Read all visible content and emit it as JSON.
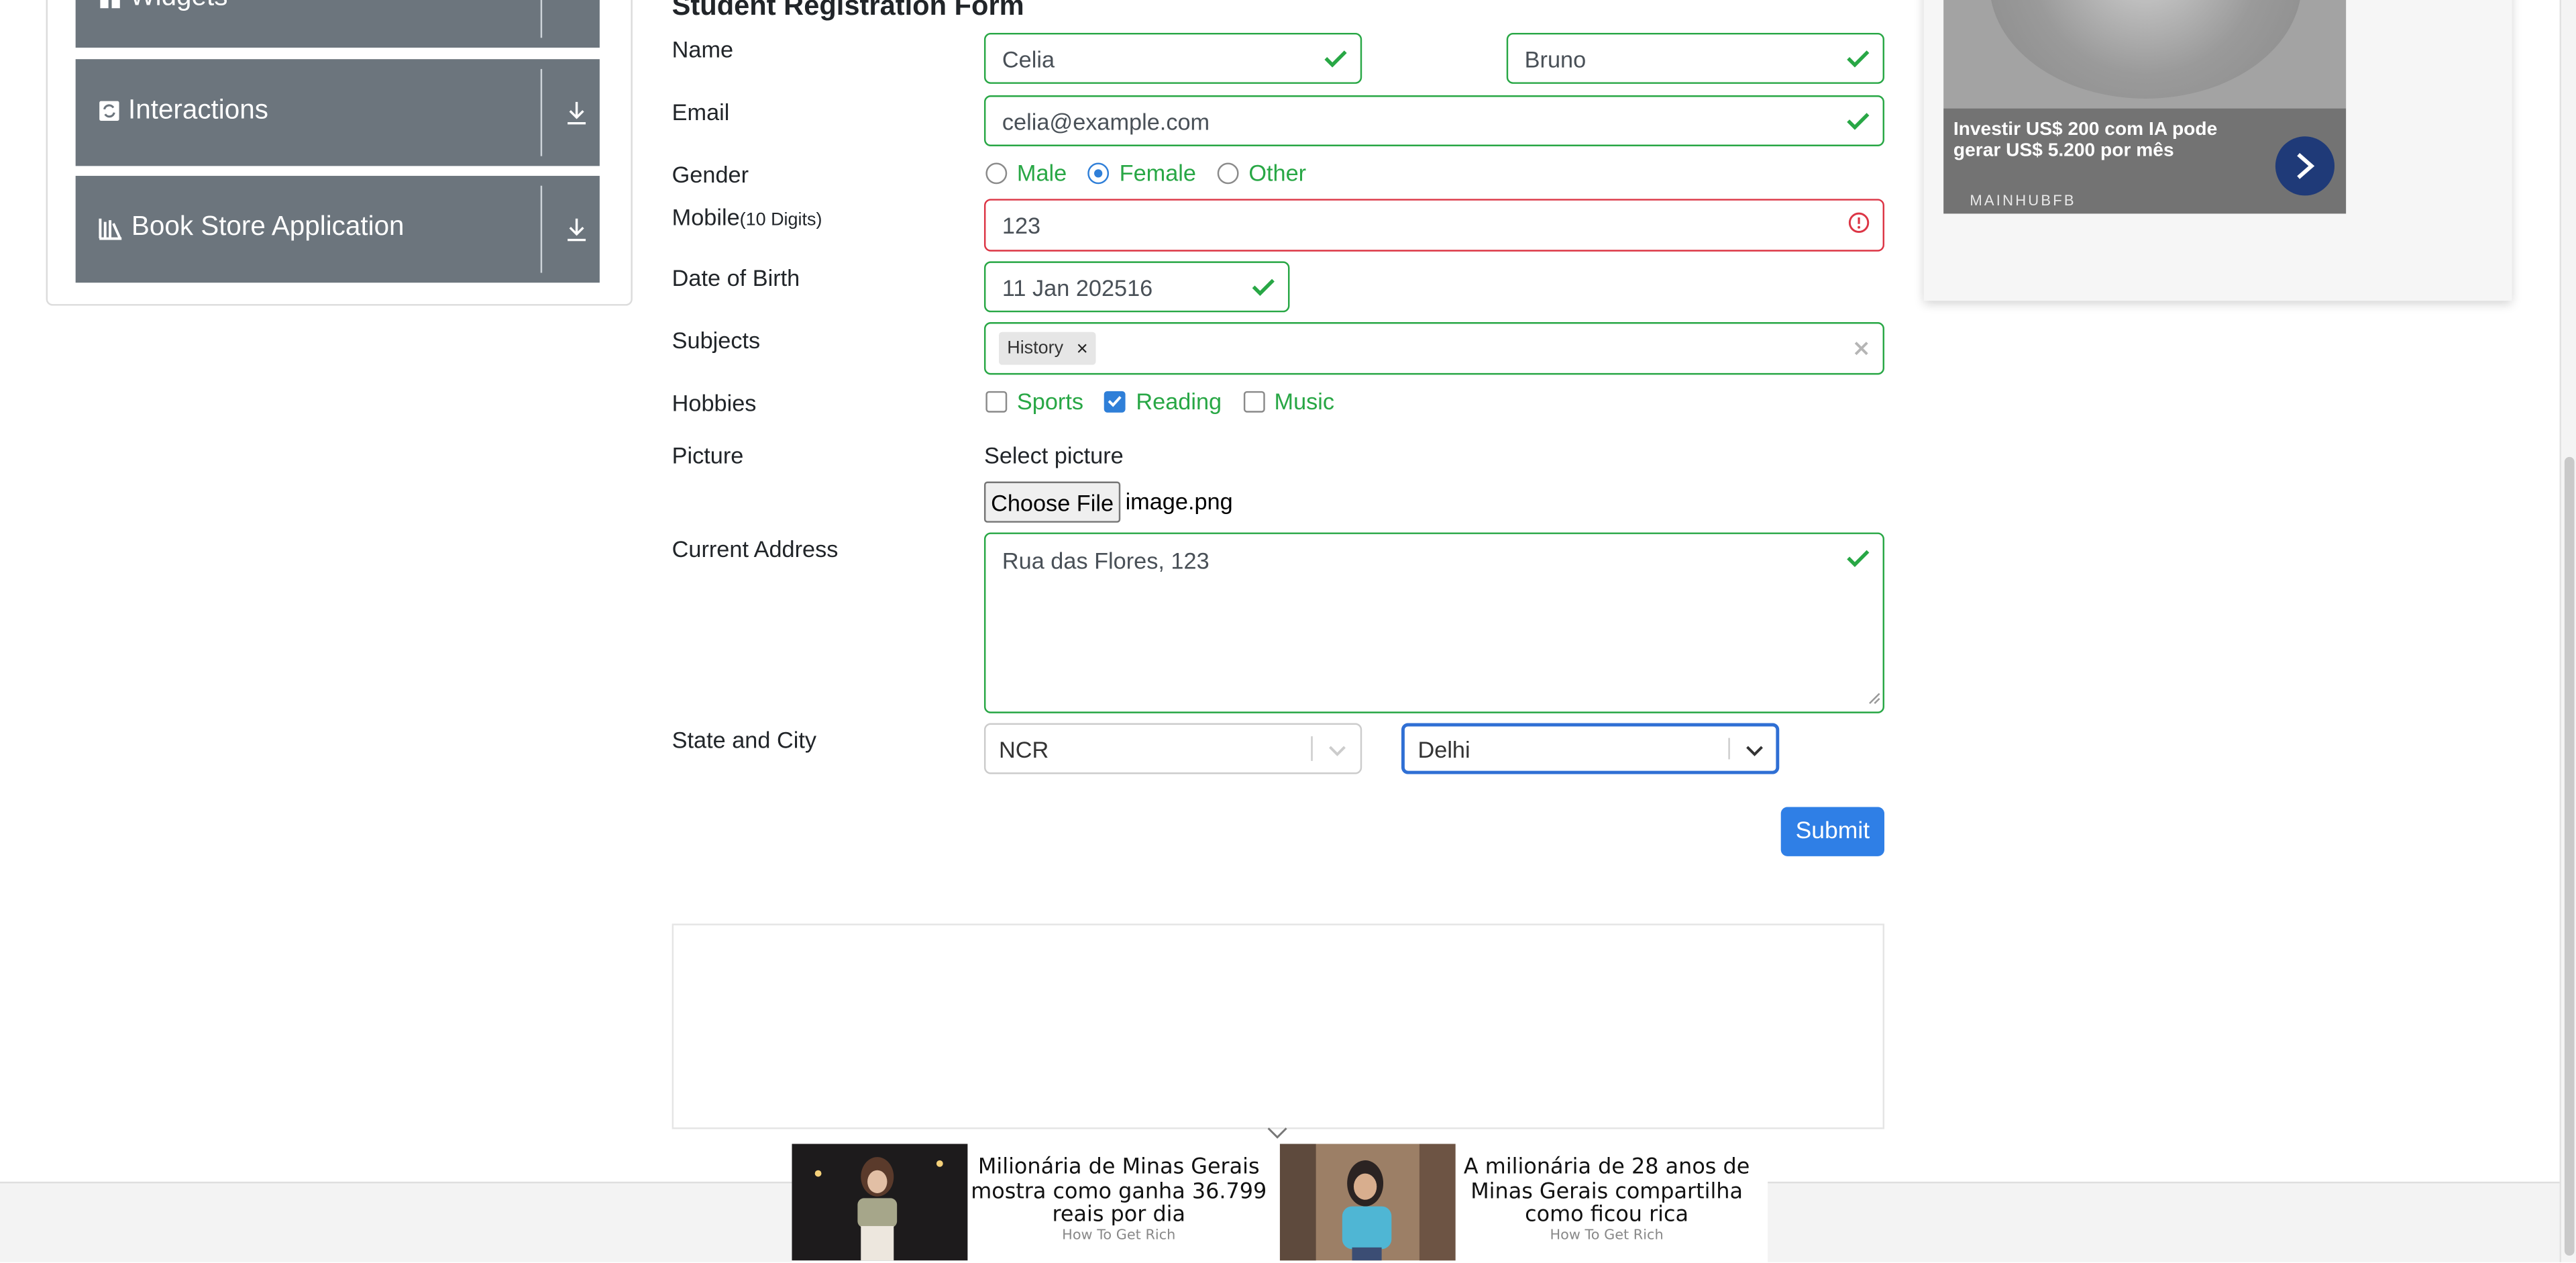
{
  "sidebar": {
    "groups": [
      {
        "label": "Widgets",
        "icon": "widgets-icon"
      },
      {
        "label": "Interactions",
        "icon": "interactions-icon"
      },
      {
        "label": "Book Store Application",
        "icon": "book-store-icon"
      }
    ]
  },
  "form": {
    "title": "Student Registration Form",
    "name_label": "Name",
    "first_name": "Celia",
    "last_name": "Bruno",
    "email_label": "Email",
    "email": "celia@example.com",
    "gender_label": "Gender",
    "gender_options": [
      "Male",
      "Female",
      "Other"
    ],
    "gender_selected": "Female",
    "mobile_label": "Mobile",
    "mobile_hint": "(10 Digits)",
    "mobile": "123",
    "dob_label": "Date of Birth",
    "dob": "11 Jan 202516",
    "subjects_label": "Subjects",
    "subjects": [
      "History"
    ],
    "hobbies_label": "Hobbies",
    "hobbies": [
      "Sports",
      "Reading",
      "Music"
    ],
    "hobbies_checked": [
      "Reading"
    ],
    "picture_label": "Picture",
    "select_picture": "Select picture",
    "choose_file": "Choose File",
    "file_name": "image.png",
    "address_label": "Current Address",
    "address": "Rua das Flores, 123",
    "state_city_label": "State and City",
    "state": "NCR",
    "city": "Delhi",
    "submit": "Submit"
  },
  "ad_right": {
    "title": "Investir US$ 200 com IA pode gerar US$ 5.200 por mês",
    "brand": "MAINHUBFB"
  },
  "ad_bottom": {
    "items": [
      {
        "title": "Milionária de Minas Gerais mostra como ganha 36.799 reais por dia",
        "source": "How To Get Rich"
      },
      {
        "title": "A milionária de 28 anos de Minas Gerais compartilha como ficou rica",
        "source": "How To Get Rich"
      }
    ]
  },
  "colors": {
    "valid": "#28a745",
    "invalid": "#dc3545",
    "primary": "#2f7fe6",
    "sidebar_group": "#6c757d"
  }
}
